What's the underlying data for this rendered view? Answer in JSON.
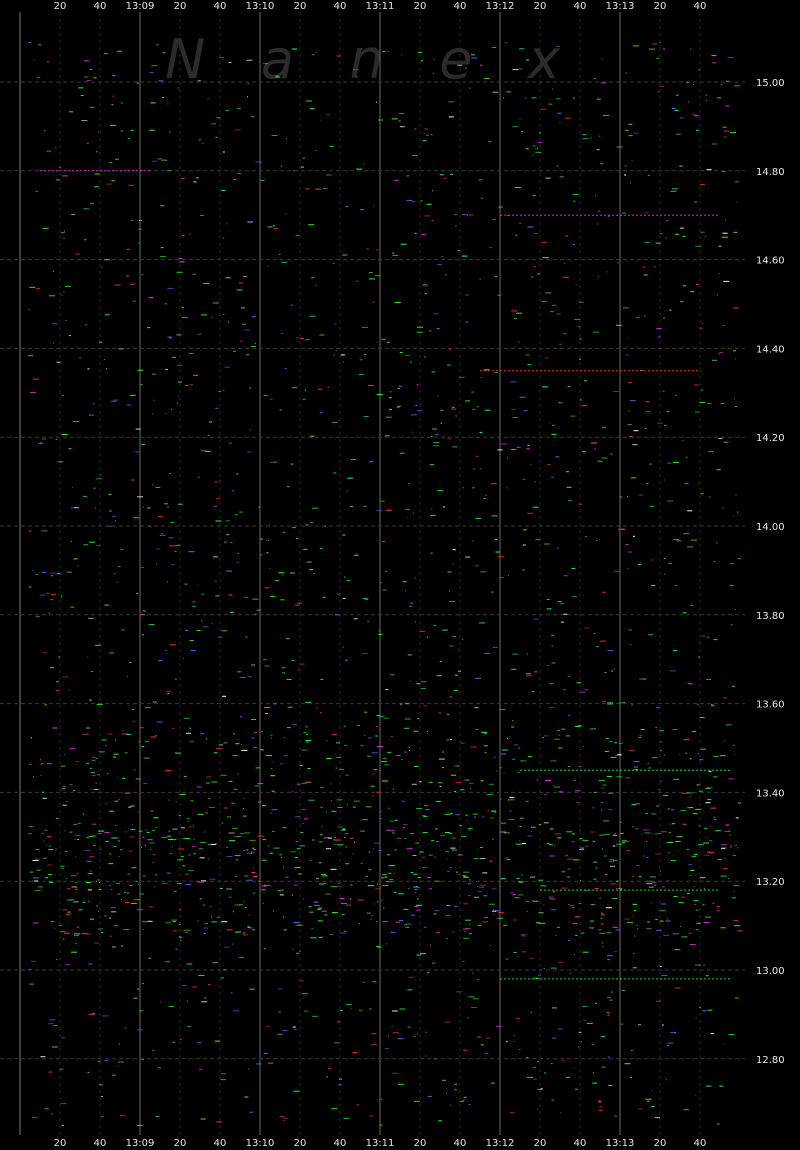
{
  "chart_data": {
    "type": "scatter",
    "title": "",
    "xlabel": "",
    "ylabel": "",
    "watermark": "Nanex",
    "x_tick_labels": [
      "20",
      "40",
      "13:09",
      "20",
      "40",
      "13:10",
      "20",
      "40",
      "13:11",
      "20",
      "40",
      "13:12",
      "20",
      "40",
      "13:13",
      "20",
      "40"
    ],
    "y_ticks": [
      15.0,
      14.8,
      14.6,
      14.4,
      14.2,
      14.0,
      13.8,
      13.6,
      13.4,
      13.2,
      13.0,
      12.8
    ],
    "y_tick_labels": [
      "15.00",
      "14.80",
      "14.60",
      "14.40",
      "14.20",
      "14.00",
      "13.80",
      "13.60",
      "13.40",
      "13.20",
      "13.00",
      "12.80"
    ],
    "ylim": [
      12.68,
      15.18
    ],
    "xlim": [
      "13:08:29",
      "13:13:51"
    ],
    "grid": true,
    "series": [
      {
        "color": "#33ff33",
        "density": 0.55
      },
      {
        "color": "#ff3333",
        "density": 0.15
      },
      {
        "color": "#6666ff",
        "density": 0.15
      },
      {
        "color": "#ff33ff",
        "density": 0.08
      },
      {
        "color": "#ffffff",
        "density": 0.07
      }
    ],
    "colors": {
      "background": "#000000",
      "grid_minor": "#2a2a2a",
      "grid_major": "#6a6a6a",
      "label": "#e6e6e6"
    }
  }
}
